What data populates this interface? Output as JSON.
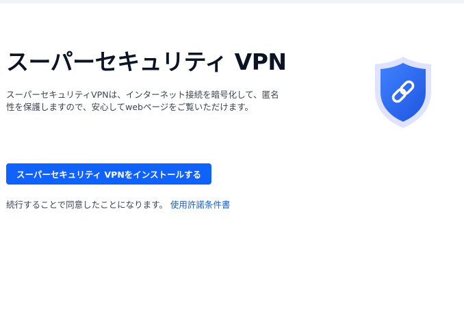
{
  "header": {
    "title": "スーパーセキュリティ VPN"
  },
  "main": {
    "description": "スーパーセキュリティVPNは、インターネット接続を暗号化して、匿名性を保護しますので、安心してwebページをご覧いただけます。",
    "install_label": "スーパーセキュリティ VPNをインストールする",
    "agreement_text": "続行することで同意したことになります。",
    "terms_link": "使用許諾条件書"
  },
  "icons": {
    "shield": "shield-link-icon"
  },
  "colors": {
    "accent": "#0f62fe",
    "link": "#0b5fd4",
    "title": "#0b1424",
    "body_text": "#3a4350",
    "shield_outer": "#d9ddff",
    "shield_inner": "#2f6df6"
  }
}
